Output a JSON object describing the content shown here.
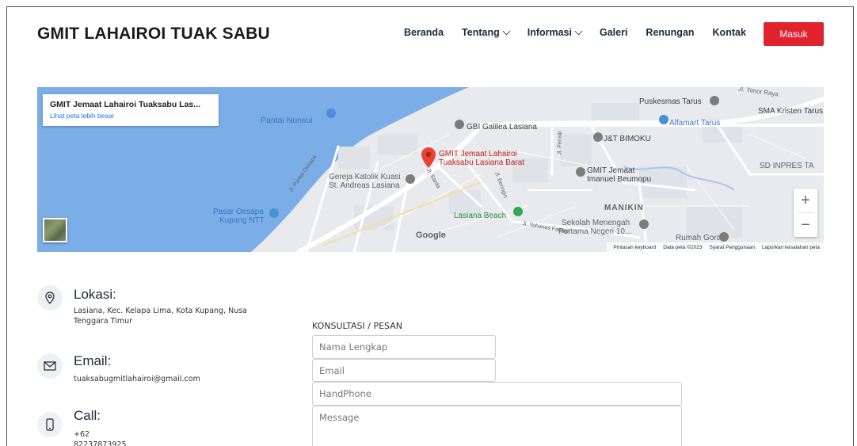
{
  "header": {
    "site_title": "GMIT LAHAIROI TUAK SABU",
    "nav": [
      {
        "label": "Beranda",
        "has_dropdown": false
      },
      {
        "label": "Tentang",
        "has_dropdown": true
      },
      {
        "label": "Informasi",
        "has_dropdown": true
      },
      {
        "label": "Galeri",
        "has_dropdown": false
      },
      {
        "label": "Renungan",
        "has_dropdown": false
      },
      {
        "label": "Kontak",
        "has_dropdown": false
      }
    ],
    "login_label": "Masuk"
  },
  "map": {
    "card_title": "GMIT Jemaat Lahairoi Tuaksabu Las...",
    "card_link": "Lihat peta lebih besar",
    "labels": {
      "pantai_nunsui": "Pantai Nunsui",
      "gbi": "GBI Galilea Lasiana",
      "puskesmas": "Puskesmas Tarus",
      "sma": "SMA Kristen Tarus",
      "alfamart": "Alfamart Tarus",
      "jt": "J&T BIMOKU",
      "pin_line1": "GMIT Jemaat Lahairoi",
      "pin_line2": "Tuaksabu Lasiana Barat",
      "gereja1": "Gereja Katolik Kuasi",
      "gereja2": "St. Andreas Lasiana",
      "imanuel1": "GMIT Jemaat",
      "imanuel2": "Imanuel Beumopu",
      "sd": "SD INPRES TA",
      "manikin": "MANIKIN",
      "pasar1": "Pasar Oesapa",
      "pasar2": "Kupang NTT",
      "beach": "Lasiana Beach",
      "smp1": "Sekolah Menengah",
      "smp2": "Pertama Negeri 10...",
      "rumah": "Rumah Goran",
      "road_raya": "Jl. Timor Raya",
      "road_pantai": "Jl. Pantai Oesapa",
      "road_yohanes": "Jl. Yohanes Fanggi",
      "road_pensip": "Jl. Pensip",
      "road_sarda": "Jl. Sarda",
      "road_beringin": "Jl. Beringin"
    },
    "zoom_in": "+",
    "zoom_out": "−",
    "google": "Google",
    "footer": [
      "Pintasan keyboard",
      "Data peta ©2023",
      "Syarat Penggunaan",
      "Laporkan kesalahan peta"
    ]
  },
  "contact": {
    "location_heading": "Lokasi:",
    "location_value": "Lasiana, Kec. Kelapa Lima, Kota Kupang, Nusa Tenggara Timur",
    "email_heading": "Email:",
    "email_value": "tuaksabugmitlahairoi@gmail.com",
    "call_heading": "Call:",
    "call_value": "+62 82237873925"
  },
  "form": {
    "label": "KONSULTASI / PESAN",
    "name_placeholder": "Nama Lengkap",
    "email_placeholder": "Email",
    "phone_placeholder": "HandPhone",
    "message_placeholder": "Message"
  },
  "colors": {
    "accent": "#e0232e",
    "map_water": "#7baee6",
    "map_land": "#e8eaed",
    "link_blue": "#1a73e8"
  },
  "icons": [
    "chevron-down-icon",
    "map-pin-icon",
    "location-icon",
    "mail-icon",
    "phone-icon"
  ]
}
